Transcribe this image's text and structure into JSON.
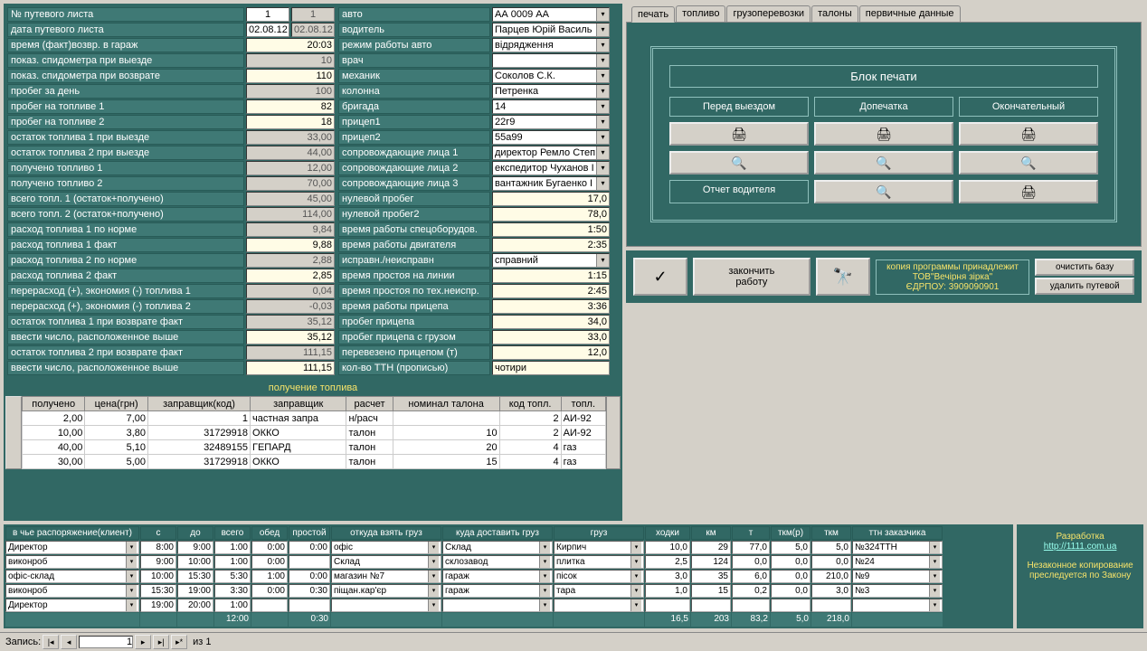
{
  "left_fields": [
    {
      "label": "№ путевого листа",
      "v1": "1",
      "v2": "1",
      "c1": "val",
      "c2": "val gray"
    },
    {
      "label": "дата путевого листа",
      "v1": "02.08.12",
      "v2": "02.08.12",
      "c1": "val",
      "c2": "val gray"
    },
    {
      "label": "время (факт)возвр. в гараж",
      "v": "20:03",
      "c": "val yel"
    },
    {
      "label": "показ. спидометра при выезде",
      "v": "10",
      "c": "val gray"
    },
    {
      "label": "показ. спидометра при возврате",
      "v": "110",
      "c": "val yel"
    },
    {
      "label": "пробег за день",
      "v": "100",
      "c": "val gray"
    },
    {
      "label": "пробег на топливе 1",
      "v": "82",
      "c": "val yel"
    },
    {
      "label": "пробег на топливе 2",
      "v": "18",
      "c": "val yel"
    },
    {
      "label": "остаток  топлива 1 при выезде",
      "v": "33,00",
      "c": "val gray"
    },
    {
      "label": "остаток топлива 2 при выезде",
      "v": "44,00",
      "c": "val gray"
    },
    {
      "label": "получено топливо 1",
      "v": "12,00",
      "c": "val gray"
    },
    {
      "label": "получено топливо 2",
      "v": "70,00",
      "c": "val gray"
    },
    {
      "label": "всего топл. 1 (остаток+получено)",
      "v": "45,00",
      "c": "val gray"
    },
    {
      "label": "всего топл. 2 (остаток+получено)",
      "v": "114,00",
      "c": "val gray"
    },
    {
      "label": "расход топлива 1 по норме",
      "v": "9,84",
      "c": "val gray"
    },
    {
      "label": "расход топлива 1 факт",
      "v": "9,88",
      "c": "val yel"
    },
    {
      "label": "расход топлива 2 по норме",
      "v": "2,88",
      "c": "val gray"
    },
    {
      "label": "расход топлива 2 факт",
      "v": "2,85",
      "c": "val yel"
    },
    {
      "label": "перерасход (+), экономия (-) топлива 1",
      "v": "0,04",
      "c": "val gray"
    },
    {
      "label": "перерасход (+), экономия (-) топлива 2",
      "v": "-0,03",
      "c": "val gray"
    },
    {
      "label": "остаток топлива 1 при возврате факт",
      "v": "35,12",
      "c": "val gray"
    },
    {
      "label": "ввести число, расположенное выше",
      "v": "35,12",
      "c": "val yel"
    },
    {
      "label": "остаток топлива 2 при возврате факт",
      "v": "111,15",
      "c": "val gray"
    },
    {
      "label": "ввести число, расположенное выше",
      "v": "111,15",
      "c": "val yel"
    }
  ],
  "right_fields": [
    {
      "label": "авто",
      "v": "АА 0009 АА",
      "t": "select"
    },
    {
      "label": "водитель",
      "v": "Парцев Юрій Василь",
      "t": "select"
    },
    {
      "label": "режим работы авто",
      "v": "відрядження",
      "t": "select"
    },
    {
      "label": "врач",
      "v": "",
      "t": "select"
    },
    {
      "label": "механик",
      "v": "Соколов С.К.",
      "t": "select"
    },
    {
      "label": "колонна",
      "v": "Петренка",
      "t": "select"
    },
    {
      "label": "бригада",
      "v": "14",
      "t": "select"
    },
    {
      "label": "прицеп1",
      "v": "22г9",
      "t": "select"
    },
    {
      "label": "прицеп2",
      "v": "55а99",
      "t": "select"
    },
    {
      "label": "сопровождающие  лица 1",
      "v": "директор Ремло Степ",
      "t": "select"
    },
    {
      "label": "сопровождающие лица 2",
      "v": "експедитор Чуханов І",
      "t": "select"
    },
    {
      "label": "сопровождающие лица 3",
      "v": "вантажник Бугаенко І",
      "t": "select"
    },
    {
      "label": "нулевой пробег",
      "v": "17,0",
      "t": "val"
    },
    {
      "label": "нулевой пробег2",
      "v": "78,0",
      "t": "val"
    },
    {
      "label": "время работы спецоборудов.",
      "v": "1:50",
      "t": "val"
    },
    {
      "label": "время работы двигателя",
      "v": "2:35",
      "t": "val"
    },
    {
      "label": "исправн./неисправн",
      "v": "справний",
      "t": "select"
    },
    {
      "label": "время простоя на линии",
      "v": "1:15",
      "t": "val"
    },
    {
      "label": "время простоя по тех.неиспр.",
      "v": "2:45",
      "t": "val"
    },
    {
      "label": "время работы прицепа",
      "v": "3:36",
      "t": "val"
    },
    {
      "label": "пробег прицепа",
      "v": "34,0",
      "t": "val"
    },
    {
      "label": "пробег прицепа с грузом",
      "v": "33,0",
      "t": "val"
    },
    {
      "label": "перевезено прицепом (т)",
      "v": "12,0",
      "t": "val"
    },
    {
      "label": "кол-во ТТН (прописью)",
      "v": "чотири",
      "t": "valleft"
    }
  ],
  "fuel_title": "получение топлива",
  "fuel_headers": [
    "получено",
    "цена(грн)",
    "заправщик(код)",
    "заправщик",
    "расчет",
    "номинал талона",
    "код топл.",
    "топл."
  ],
  "fuel_rows": [
    [
      "2,00",
      "7,00",
      "1",
      "частная запра",
      "н/расч",
      "",
      "2",
      "АИ-92"
    ],
    [
      "10,00",
      "3,80",
      "31729918",
      "ОККО",
      "талон",
      "10",
      "2",
      "АИ-92"
    ],
    [
      "40,00",
      "5,10",
      "32489155",
      "ГЕПАРД",
      "талон",
      "20",
      "4",
      "газ"
    ],
    [
      "30,00",
      "5,00",
      "31729918",
      "ОККО",
      "талон",
      "15",
      "4",
      "газ"
    ]
  ],
  "tabs": [
    "печать",
    "топливо",
    "грузоперевозки",
    "талоны",
    "первичные данные"
  ],
  "print": {
    "title": "Блок печати",
    "cols": [
      "Перед выездом",
      "Допечатка",
      "Окончательный"
    ],
    "driver_report": "Отчет водителя"
  },
  "action": {
    "finish": "закончить\nработу",
    "copy1": "копия программы принадлежит",
    "copy2": "ТОВ\"Вечірня зірка\"",
    "copy3": "ЄДРПОУ: 3909090901",
    "clean": "очистить базу",
    "delete": "удалить путевой"
  },
  "dispatch_headers": [
    "в чье распоряжение(клиент)",
    "с",
    "до",
    "всего",
    "обед",
    "простой",
    "откуда взять груз",
    "куда доставить груз",
    "груз",
    "ходки",
    "км",
    "т",
    "ткм(р)",
    "ткм",
    "ттн заказчика"
  ],
  "dispatch_rows": [
    {
      "client": "Директор",
      "s": "8:00",
      "do": "9:00",
      "vs": "1:00",
      "ob": "0:00",
      "pr": "0:00",
      "from": "офіс",
      "to": "Склад",
      "cargo": "Кирпич",
      "hod": "10,0",
      "km": "29",
      "t": "77,0",
      "tkmr": "5,0",
      "tkm": "5,0",
      "ttn": "№324ТТН"
    },
    {
      "client": "виконроб",
      "s": "9:00",
      "do": "10:00",
      "vs": "1:00",
      "ob": "0:00",
      "pr": "",
      "from": "Склад",
      "to": "склозавод",
      "cargo": "плитка",
      "hod": "2,5",
      "km": "124",
      "t": "0,0",
      "tkmr": "0,0",
      "tkm": "0,0",
      "ttn": "№24"
    },
    {
      "client": "офіс-склад",
      "s": "10:00",
      "do": "15:30",
      "vs": "5:30",
      "ob": "1:00",
      "pr": "0:00",
      "from": "магазин №7",
      "to": "гараж",
      "cargo": "пісок",
      "hod": "3,0",
      "km": "35",
      "t": "6,0",
      "tkmr": "0,0",
      "tkm": "210,0",
      "ttn": "№9"
    },
    {
      "client": "виконроб",
      "s": "15:30",
      "do": "19:00",
      "vs": "3:30",
      "ob": "0:00",
      "pr": "0:30",
      "from": "піщан.кар'єр",
      "to": "гараж",
      "cargo": "тара",
      "hod": "1,0",
      "km": "15",
      "t": "0,2",
      "tkmr": "0,0",
      "tkm": "3,0",
      "ttn": "№3"
    },
    {
      "client": "Директор",
      "s": "19:00",
      "do": "20:00",
      "vs": "1:00",
      "ob": "",
      "pr": "",
      "from": "",
      "to": "",
      "cargo": "",
      "hod": "",
      "km": "",
      "t": "",
      "tkmr": "",
      "tkm": "",
      "ttn": ""
    }
  ],
  "dispatch_totals": {
    "vs": "12:00",
    "pr": "0:30",
    "hod": "16,5",
    "km": "203",
    "t": "83,2",
    "tkmr": "5,0",
    "tkm": "218,0"
  },
  "credits": {
    "dev": "Разработка",
    "url": "http://1111.com.ua",
    "warn1": "Незаконное копирование",
    "warn2": "преследуется по Закону"
  },
  "record": {
    "label": "Запись:",
    "pos": "1",
    "of": "из  1"
  }
}
